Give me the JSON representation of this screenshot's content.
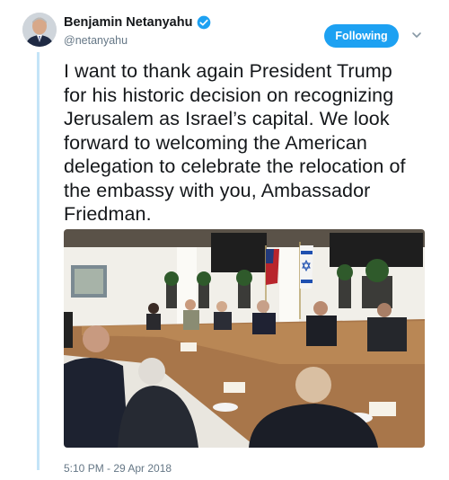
{
  "author": {
    "display_name": "Benjamin Netanyahu",
    "handle": "@netanyahu",
    "verified_icon": "verified-badge-icon",
    "avatar_icon": "profile-photo"
  },
  "follow_button": {
    "label": "Following",
    "color": "#1da1f2"
  },
  "menu_icon": "chevron-down-icon",
  "tweet": {
    "lines": [
      "I want to thank again President Trump",
      "for his historic decision on recognizing",
      "Jerusalem as Israel’s capital. We look",
      "forward to welcoming the American",
      "delegation to celebrate the relocation of",
      "the embassy with you, Ambassador",
      "Friedman."
    ]
  },
  "media": {
    "type": "photo",
    "subject": "meeting-room-photo"
  },
  "timestamp": "5:10 PM - 29 Apr 2018",
  "colors": {
    "thread_line": "#c4e4f7",
    "secondary_text": "#657786",
    "primary_text": "#14171a"
  }
}
